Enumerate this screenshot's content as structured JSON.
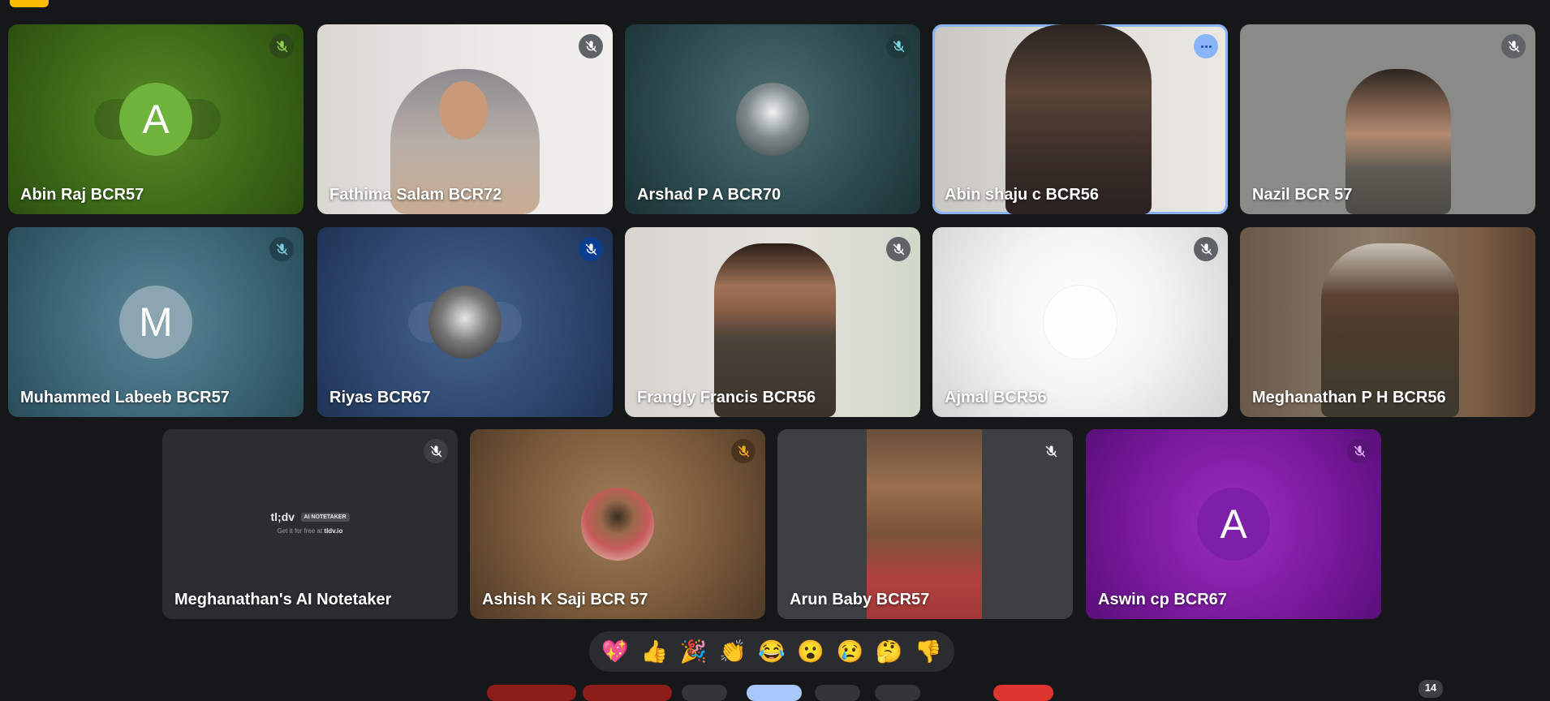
{
  "participants": [
    {
      "name": "Abin Raj BCR57",
      "initial": "A"
    },
    {
      "name": "Fathima Salam BCR72"
    },
    {
      "name": "Arshad P A BCR70"
    },
    {
      "name": "Abin shaju c BCR56"
    },
    {
      "name": "Nazil BCR 57"
    },
    {
      "name": "Muhammed Labeeb BCR57",
      "initial": "M"
    },
    {
      "name": "Riyas BCR67"
    },
    {
      "name": "Frangly Francis BCR56"
    },
    {
      "name": "Ajmal BCR56"
    },
    {
      "name": "Meghanathan P H BCR56"
    },
    {
      "name": "Meghanathan's AI Notetaker"
    },
    {
      "name": "Ashish K Saji BCR 57"
    },
    {
      "name": "Arun Baby BCR57"
    },
    {
      "name": "Aswin cp BCR67",
      "initial": "A"
    }
  ],
  "notetaker": {
    "logo": "tl;dv",
    "badge": "AI NOTETAKER",
    "tagline_prefix": "Get it for free at",
    "tagline_link": "tldv.io"
  },
  "reactions": [
    "💖",
    "👍",
    "🎉",
    "👏",
    "😂",
    "😮",
    "😢",
    "🤔",
    "👎"
  ],
  "participant_count": "14",
  "colors": {
    "background": "#161719",
    "active_speaker_border": "#8ab4f8",
    "raise_hand_pill": "#f9bb04"
  },
  "icons": {
    "mic_off": "mic-off-icon",
    "more": "more-options-icon"
  }
}
